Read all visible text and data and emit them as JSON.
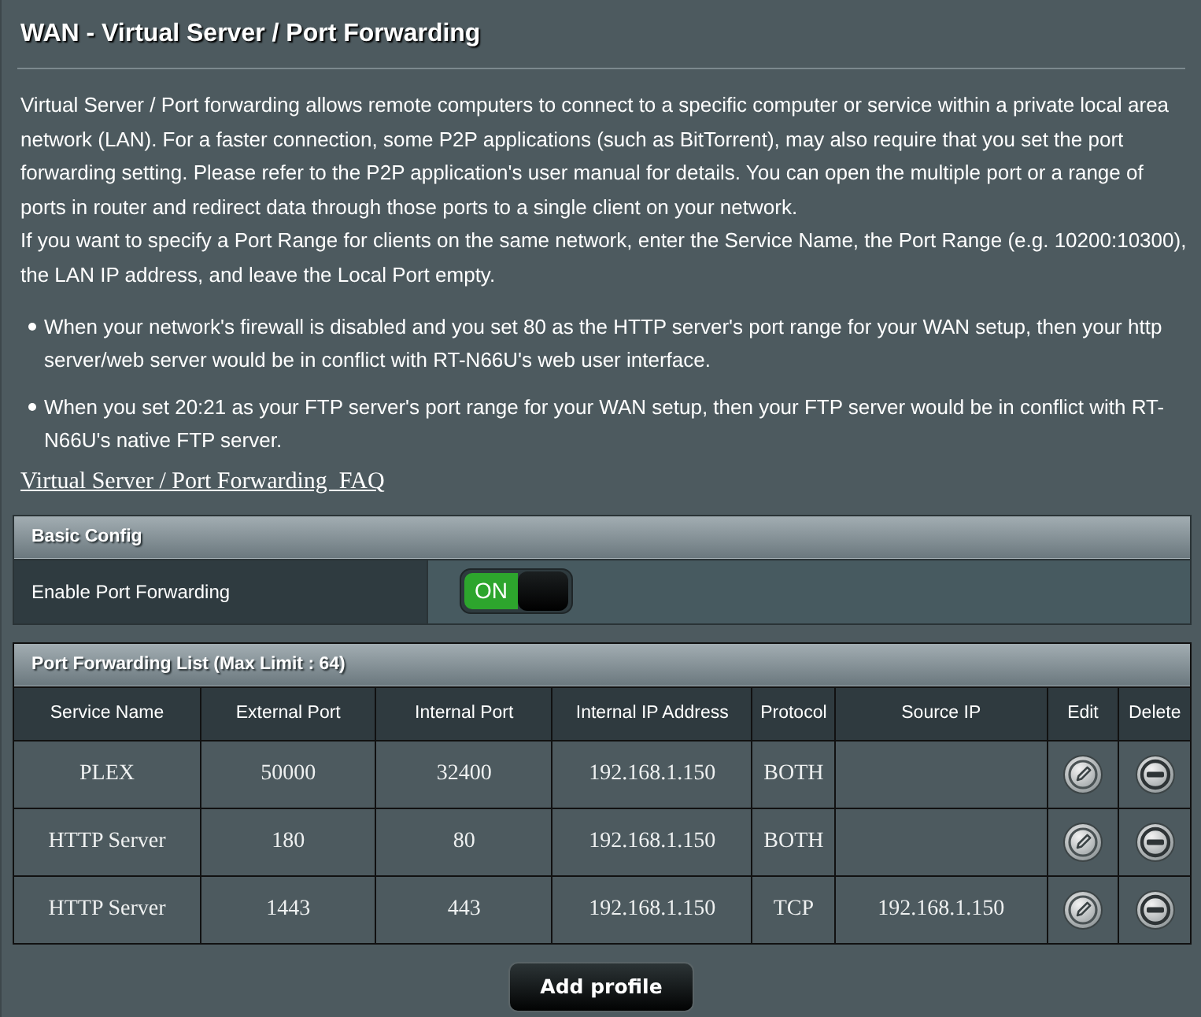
{
  "page": {
    "title": "WAN - Virtual Server / Port Forwarding",
    "description": [
      "Virtual Server / Port forwarding allows remote computers to connect to a specific computer or service within a private local area network (LAN). For a faster connection, some P2P applications (such as BitTorrent), may also require that you set the port forwarding setting. Please refer to the P2P application's user manual for details. You can open the multiple port or a range of ports in router and redirect data through those ports to a single client on your network.",
      "If you want to specify a Port Range for clients on the same network, enter the Service Name, the Port Range (e.g. 10200:10300), the LAN IP address, and leave the Local Port empty."
    ],
    "notes": [
      "When your network's firewall is disabled and you set 80 as the HTTP server's port range for your WAN setup, then your http server/web server would be in conflict with RT-N66U's web user interface.",
      "When you set 20:21 as your FTP server's port range for your WAN setup, then your FTP server would be in conflict with RT-N66U's native FTP server."
    ],
    "faq_link": "Virtual Server / Port Forwarding  FAQ"
  },
  "basic_config": {
    "title": "Basic Config",
    "rows": [
      {
        "label": "Enable Port Forwarding",
        "kind": "toggle",
        "on": true,
        "toggle_label": "ON"
      }
    ]
  },
  "port_forwarding_list": {
    "title": "Port Forwarding List (Max Limit : 64)",
    "columns": [
      "Service Name",
      "External Port",
      "Internal Port",
      "Internal IP Address",
      "Protocol",
      "Source IP",
      "Edit",
      "Delete"
    ],
    "rows": [
      {
        "service_name": "PLEX",
        "external_port": "50000",
        "internal_port": "32400",
        "internal_ip": "192.168.1.150",
        "protocol": "BOTH"
      },
      {
        "service_name": "HTTP Server",
        "external_port": "180",
        "internal_port": "80",
        "internal_ip": "192.168.1.150",
        "protocol": "BOTH"
      },
      {
        "service_name": "HTTP Server",
        "external_port": "1443",
        "internal_port": "443",
        "internal_ip": "192.168.1.150",
        "protocol": "TCP",
        "source_ip": "192.168.1.150"
      }
    ]
  },
  "add_button": "Add profile"
}
